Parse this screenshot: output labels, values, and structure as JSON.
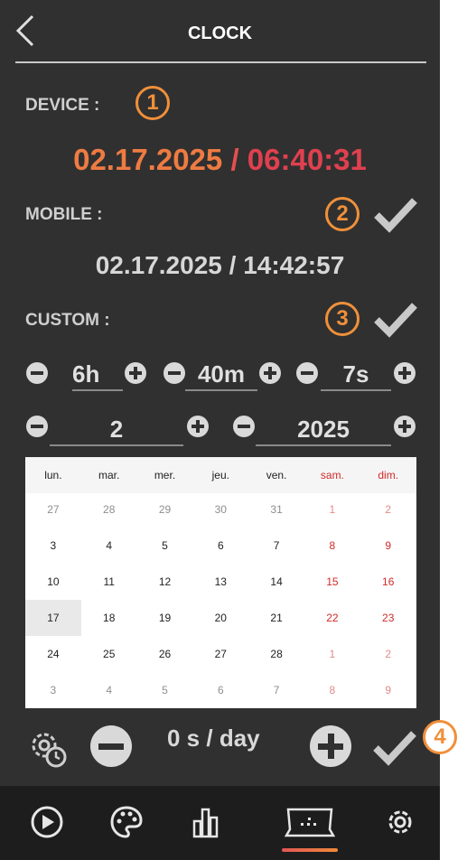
{
  "header": {
    "title": "CLOCK"
  },
  "device": {
    "label": "DEVICE :",
    "badge": "1",
    "date": "02.17.2025",
    "separator": "/",
    "time": "06:40:31"
  },
  "mobile": {
    "label": "MOBILE :",
    "badge": "2",
    "date": "02.17.2025",
    "separator": "/",
    "time": "14:42:57"
  },
  "custom": {
    "label": "CUSTOM :",
    "badge": "3",
    "hours": "6h",
    "minutes": "40m",
    "seconds": "7s",
    "month": "2",
    "year": "2025"
  },
  "calendar": {
    "weekdays": [
      "lun.",
      "mar.",
      "mer.",
      "jeu.",
      "ven.",
      "sam.",
      "dim."
    ],
    "weeks": [
      [
        "27",
        "28",
        "29",
        "30",
        "31",
        "1",
        "2"
      ],
      [
        "3",
        "4",
        "5",
        "6",
        "7",
        "8",
        "9"
      ],
      [
        "10",
        "11",
        "12",
        "13",
        "14",
        "15",
        "16"
      ],
      [
        "17",
        "18",
        "19",
        "20",
        "21",
        "22",
        "23"
      ],
      [
        "24",
        "25",
        "26",
        "27",
        "28",
        "1",
        "2"
      ],
      [
        "3",
        "4",
        "5",
        "6",
        "7",
        "8",
        "9"
      ]
    ],
    "selected": "17"
  },
  "drift": {
    "value": "0 s / day",
    "badge": "4"
  },
  "nav": {
    "items": [
      "play-icon",
      "palette-icon",
      "bar-chart-icon",
      "display-icon",
      "gear-icon"
    ],
    "active": "display-icon"
  },
  "colors": {
    "accent": "#f0903a",
    "device_date": "#ee7b42",
    "device_time": "#e0404f",
    "background": "#303030",
    "navbar": "#1d1d1d"
  }
}
